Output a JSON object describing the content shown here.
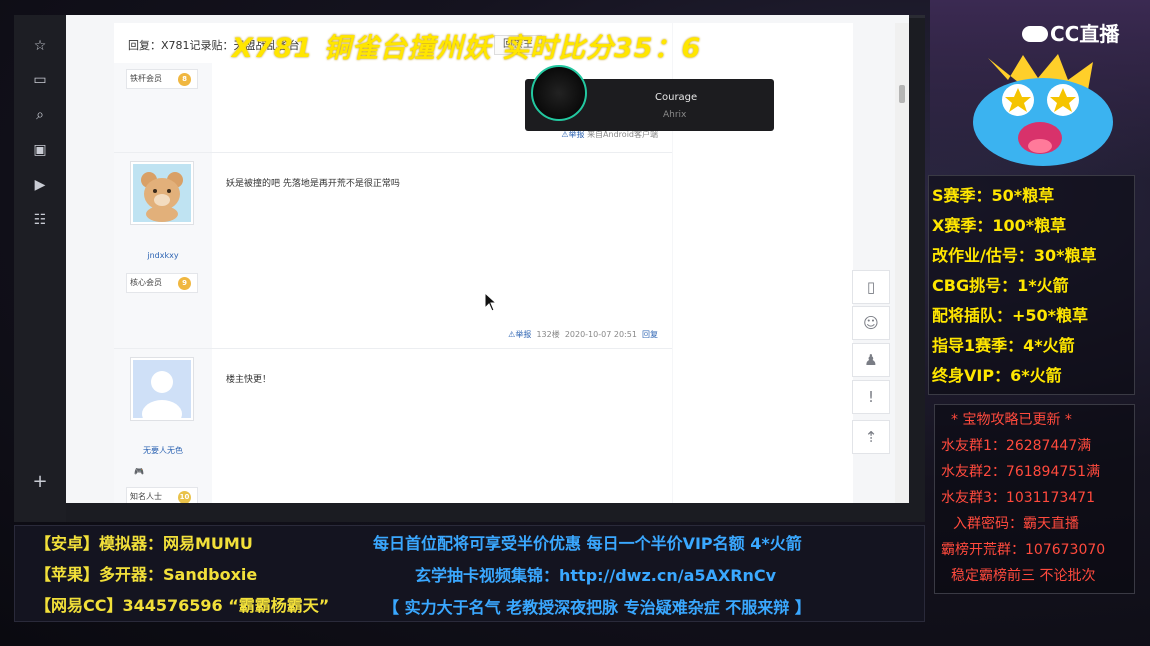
{
  "overlay": {
    "headline": "X781 铜雀台撞州妖 实时比分35：6",
    "logo": "CC直播"
  },
  "music": {
    "title": "Courage",
    "artist": "Ahrix"
  },
  "forum": {
    "reply_title": "回复：X781记录贴：天盟战乱雀台！",
    "reply_button": "回楼主",
    "posts": [
      {
        "badge": "铁杆会员",
        "level": "8",
        "report": "⚠举报",
        "source": "来自Android客户端"
      },
      {
        "username": "jndxkxy",
        "badge": "核心会员",
        "level": "9",
        "text": "妖是被撞的吧 先落地是再开荒不是很正常吗",
        "report": "⚠举报",
        "floor": "132楼",
        "time": "2020-10-07 20:51",
        "reply": "回复"
      },
      {
        "username": "无要人无色",
        "badge": "知名人士",
        "level": "10",
        "text": "楼主快更！"
      }
    ]
  },
  "prices": {
    "lines": [
      "S赛季：50*粮草",
      "X赛季：100*粮草",
      "改作业/估号：30*粮草",
      "CBG挑号：1*火箭",
      "配将插队：+50*粮草",
      "指导1赛季：4*火箭",
      "终身VIP：6*火箭"
    ]
  },
  "groups": {
    "lines": [
      "*  宝物攻略已更新  *",
      "水友群1：26287447满",
      "水友群2：761894751满",
      "水友群3：1031173471",
      "入群密码：霸天直播",
      "霸榜开荒群：107673070",
      "稳定霸榜前三 不论批次"
    ]
  },
  "bottom": {
    "left": [
      "【安卓】模拟器：网易MUMU",
      "【苹果】多开器：Sandboxie",
      "【网易CC】344576596 “霸霸杨霸天”"
    ],
    "center": [
      "每日首位配将可享受半价优惠 每日一个半价VIP名额 4*火箭",
      "玄学抽卡视频集锦：http://dwz.cn/a5AXRnCv",
      "【 实力大于名气 老教授深夜把脉 专治疑难杂症 不服来辩 】"
    ]
  },
  "colors": {
    "price_text": "#ffe600",
    "group_text": "#ff4a3d",
    "bottom_left_text": "#f2e03a",
    "bottom_center_text": "#3aa8ff",
    "music_ring": "#23c8a0"
  }
}
